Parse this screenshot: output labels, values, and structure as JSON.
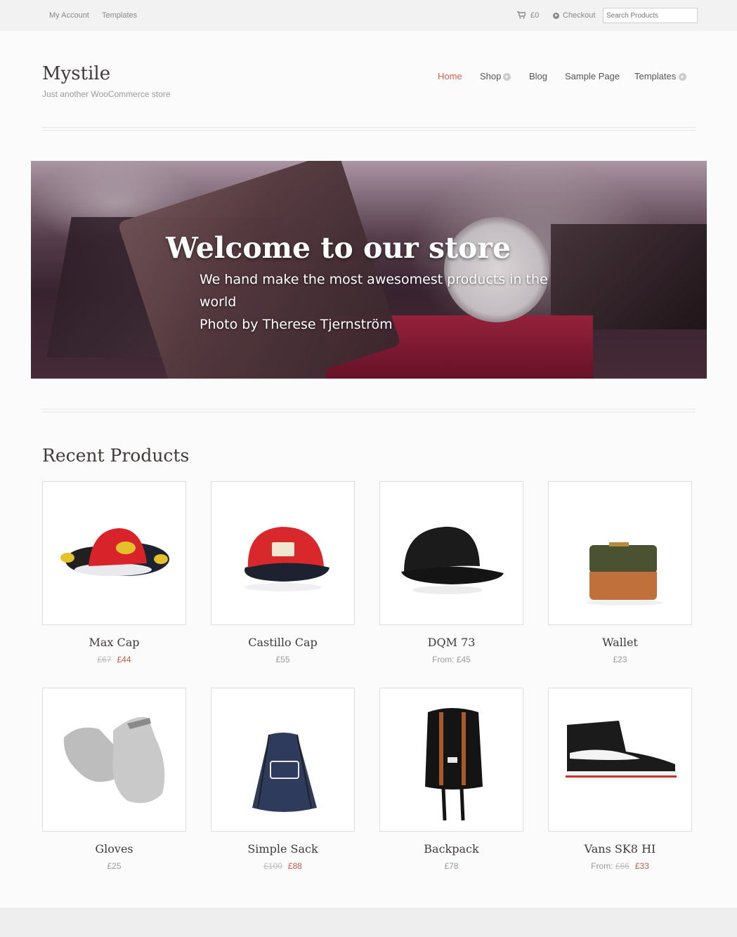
{
  "topbar": {
    "my_account": "My Account",
    "templates": "Templates",
    "cart_total": "£0",
    "checkout": "Checkout",
    "search_placeholder": "Search Products"
  },
  "header": {
    "site_title": "Mystile",
    "tagline": "Just another WooCommerce store"
  },
  "nav": {
    "items": [
      {
        "label": "Home",
        "active": true
      },
      {
        "label": "Shop",
        "has_dropdown": true
      },
      {
        "label": "Blog"
      },
      {
        "label": "Sample Page"
      },
      {
        "label": "Templates",
        "has_dropdown": true
      }
    ]
  },
  "hero": {
    "title": "Welcome to our store",
    "line1": "We hand make the most awesomest products in the",
    "line2": "world",
    "line3": "Photo by Therese Tjernström"
  },
  "products_section": {
    "title": "Recent Products",
    "items": [
      {
        "name": "Max Cap",
        "old_price": "£67",
        "price": "£44",
        "icon": "cap-icon"
      },
      {
        "name": "Castillo Cap",
        "price": "£55",
        "icon": "cap-icon"
      },
      {
        "name": "DQM 73",
        "price": "From: £45",
        "icon": "cap-icon"
      },
      {
        "name": "Wallet",
        "price": "£23",
        "icon": "wallet-icon"
      },
      {
        "name": "Gloves",
        "price": "£25",
        "icon": "gloves-icon"
      },
      {
        "name": "Simple Sack",
        "old_price": "£100",
        "price": "£88",
        "icon": "sack-icon"
      },
      {
        "name": "Backpack",
        "price": "£78",
        "icon": "backpack-icon"
      },
      {
        "name": "Vans SK8 HI",
        "price_prefix": "From:",
        "old_price": "£66",
        "price": "£33",
        "icon": "shoe-icon"
      }
    ]
  },
  "colors": {
    "accent": "#d75f55",
    "sale": "#c05a4b",
    "text": "#3f3a3a",
    "topbar_bg": "#f3f2f2"
  }
}
